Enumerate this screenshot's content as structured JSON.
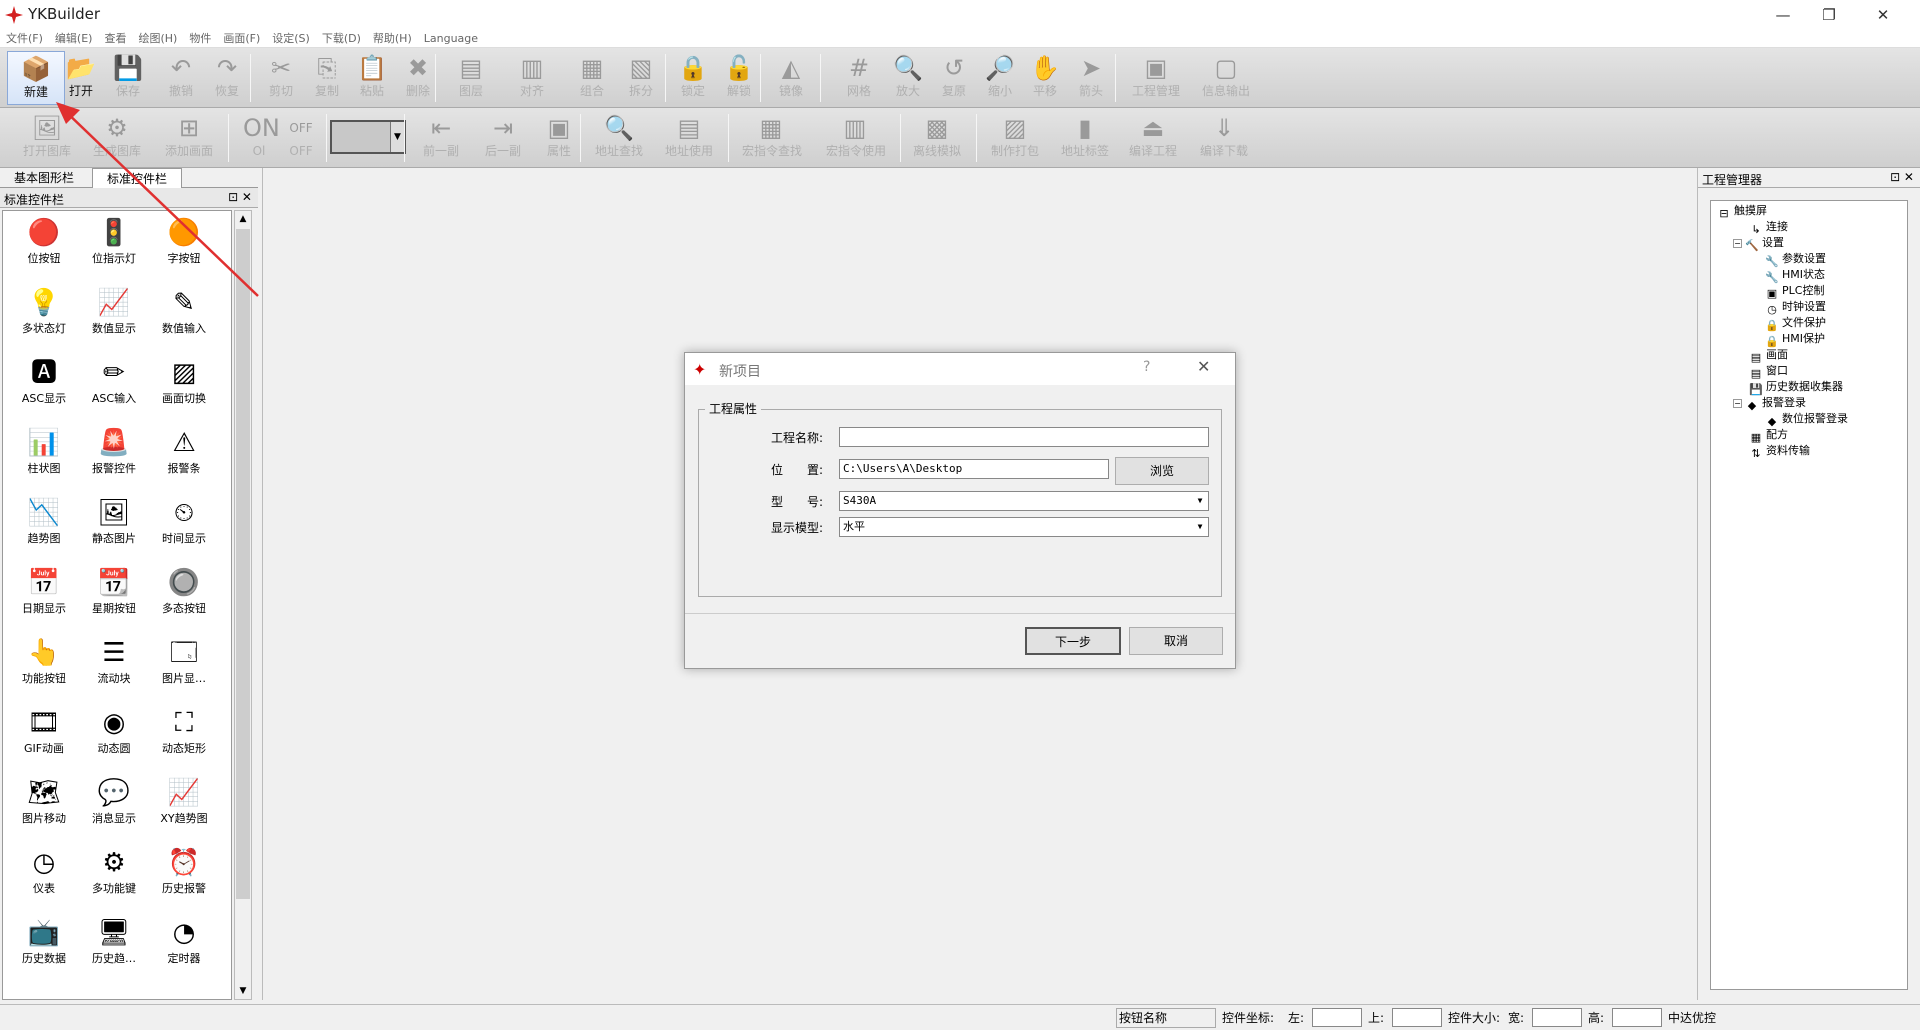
{
  "window": {
    "title": "YKBuilder",
    "minimize": "—",
    "restore": "❐",
    "close": "✕"
  },
  "menu": [
    "文件(F)",
    "编辑(E)",
    "查看",
    "绘图(H)",
    "物件",
    "画面(F)",
    "设定(S)",
    "下载(D)",
    "帮助(H)",
    "Language"
  ],
  "toolbar1": [
    {
      "label": "新建",
      "icon": "📦",
      "on": true,
      "sel": true
    },
    {
      "label": "打开",
      "icon": "📂",
      "on": true
    },
    {
      "label": "保存",
      "icon": "💾"
    },
    {
      "label": "撤销",
      "icon": "↶"
    },
    {
      "label": "恢复",
      "icon": "↷"
    },
    {
      "label": "剪切",
      "icon": "✂"
    },
    {
      "label": "复制",
      "icon": "⎘"
    },
    {
      "label": "粘贴",
      "icon": "📋"
    },
    {
      "label": "删除",
      "icon": "✖"
    },
    {
      "label": "图层",
      "icon": "▤"
    },
    {
      "label": "对齐",
      "icon": "▥"
    },
    {
      "label": "组合",
      "icon": "▦"
    },
    {
      "label": "拆分",
      "icon": "▧"
    },
    {
      "label": "锁定",
      "icon": "🔒"
    },
    {
      "label": "解锁",
      "icon": "🔓"
    },
    {
      "label": "镜像",
      "icon": "◭"
    },
    {
      "label": "网格",
      "icon": "#"
    },
    {
      "label": "放大",
      "icon": "🔍"
    },
    {
      "label": "复原",
      "icon": "↺"
    },
    {
      "label": "缩小",
      "icon": "🔎"
    },
    {
      "label": "平移",
      "icon": "✋"
    },
    {
      "label": "箭头",
      "icon": "➤"
    },
    {
      "label": "工程管理",
      "icon": "▣"
    },
    {
      "label": "信息输出",
      "icon": "▢"
    }
  ],
  "toolbar2": [
    {
      "label": "打开图库",
      "icon": "🖼"
    },
    {
      "label": "生成图库",
      "icon": "⚙"
    },
    {
      "label": "添加画面",
      "icon": "⊞"
    },
    {
      "label": "Ol",
      "icon": "ON"
    },
    {
      "label": "OFF",
      "icon": "OFF"
    },
    {
      "label": "前一副",
      "icon": "⇤"
    },
    {
      "label": "后一副",
      "icon": "⇥"
    },
    {
      "label": "属性",
      "icon": "▣"
    },
    {
      "label": "地址查找",
      "icon": "🔍"
    },
    {
      "label": "地址使用",
      "icon": "▤"
    },
    {
      "label": "宏指令查找",
      "icon": "▦"
    },
    {
      "label": "宏指令使用",
      "icon": "▥"
    },
    {
      "label": "离线模拟",
      "icon": "▩"
    },
    {
      "label": "制作打包",
      "icon": "▨"
    },
    {
      "label": "地址标签",
      "icon": "▮"
    },
    {
      "label": "编译工程",
      "icon": "⏏"
    },
    {
      "label": "编译下载",
      "icon": "⇓"
    }
  ],
  "left": {
    "tabs": [
      "基本图形栏",
      "标准控件栏"
    ],
    "panel_title": "标准控件栏",
    "panel_ctrl": "⊡ ✕",
    "items": [
      {
        "label": "位按钮",
        "icon": "🔴"
      },
      {
        "label": "位指示灯",
        "icon": "🚦"
      },
      {
        "label": "字按钮",
        "icon": "🟠"
      },
      {
        "label": "多状态灯",
        "icon": "💡"
      },
      {
        "label": "数值显示",
        "icon": "📈"
      },
      {
        "label": "数值输入",
        "icon": "✎"
      },
      {
        "label": "ASC显示",
        "icon": "🅰"
      },
      {
        "label": "ASC输入",
        "icon": "✏"
      },
      {
        "label": "画面切换",
        "icon": "▨"
      },
      {
        "label": "柱状图",
        "icon": "📊"
      },
      {
        "label": "报警控件",
        "icon": "🚨"
      },
      {
        "label": "报警条",
        "icon": "⚠"
      },
      {
        "label": "趋势图",
        "icon": "📉"
      },
      {
        "label": "静态图片",
        "icon": "🖼"
      },
      {
        "label": "时间显示",
        "icon": "⏲"
      },
      {
        "label": "日期显示",
        "icon": "📅"
      },
      {
        "label": "星期按钮",
        "icon": "📆"
      },
      {
        "label": "多态按钮",
        "icon": "🔘"
      },
      {
        "label": "功能按钮",
        "icon": "👆"
      },
      {
        "label": "流动块",
        "icon": "☰"
      },
      {
        "label": "图片显…",
        "icon": "🗔"
      },
      {
        "label": "GIF动画",
        "icon": "🎞"
      },
      {
        "label": "动态圆",
        "icon": "◉"
      },
      {
        "label": "动态矩形",
        "icon": "⛶"
      },
      {
        "label": "图片移动",
        "icon": "🗺"
      },
      {
        "label": "消息显示",
        "icon": "💬"
      },
      {
        "label": "XY趋势图",
        "icon": "📈"
      },
      {
        "label": "仪表",
        "icon": "◷"
      },
      {
        "label": "多功能键",
        "icon": "⚙"
      },
      {
        "label": "历史报警",
        "icon": "⏰"
      },
      {
        "label": "历史数据",
        "icon": "📺"
      },
      {
        "label": "历史趋…",
        "icon": "🖥"
      },
      {
        "label": "定时器",
        "icon": "◔"
      }
    ]
  },
  "right": {
    "title": "工程管理器",
    "panel_ctrl": "⊡ ✕",
    "tree": [
      {
        "label": "触摸屏",
        "icon": "⊟",
        "lvl": 0
      },
      {
        "label": "连接",
        "icon": "↳",
        "lvl": 2
      },
      {
        "label": "设置",
        "icon": "🔨",
        "lvl": 1,
        "pm": "−"
      },
      {
        "label": "参数设置",
        "icon": "🔧",
        "lvl": 3
      },
      {
        "label": "HMI状态",
        "icon": "🔧",
        "lvl": 3
      },
      {
        "label": "PLC控制",
        "icon": "▣",
        "lvl": 3
      },
      {
        "label": "时钟设置",
        "icon": "◷",
        "lvl": 3
      },
      {
        "label": "文件保护",
        "icon": "🔒",
        "lvl": 3
      },
      {
        "label": "HMI保护",
        "icon": "🔒",
        "lvl": 3
      },
      {
        "label": "画面",
        "icon": "▤",
        "lvl": 2
      },
      {
        "label": "窗口",
        "icon": "▤",
        "lvl": 2
      },
      {
        "label": "历史数据收集器",
        "icon": "💾",
        "lvl": 2
      },
      {
        "label": "报警登录",
        "icon": "◆",
        "lvl": 1,
        "pm": "−"
      },
      {
        "label": "数位报警登录",
        "icon": "◆",
        "lvl": 3
      },
      {
        "label": "配方",
        "icon": "▦",
        "lvl": 2
      },
      {
        "label": "资料传输",
        "icon": "⇅",
        "lvl": 2
      }
    ]
  },
  "dialog": {
    "title": "新项目",
    "help": "?",
    "close": "✕",
    "group": "工程属性",
    "name_label": "工程名称:",
    "name_value": "",
    "loc_label": "位　　置:",
    "loc_value": "C:\\Users\\A\\Desktop",
    "browse": "浏览",
    "model_label": "型　　号:",
    "model_value": "S430A",
    "disp_label": "显示模型:",
    "disp_value": "水平",
    "next": "下一步",
    "cancel": "取消"
  },
  "status": {
    "name": "按钮名称",
    "coord": "控件坐标:",
    "left": "左:",
    "top": "上:",
    "size": "控件大小:",
    "width": "宽:",
    "height": "高:",
    "company": "中达优控"
  },
  "colors": {
    "accent": "#3a78c3",
    "arrow": "#e03030"
  }
}
